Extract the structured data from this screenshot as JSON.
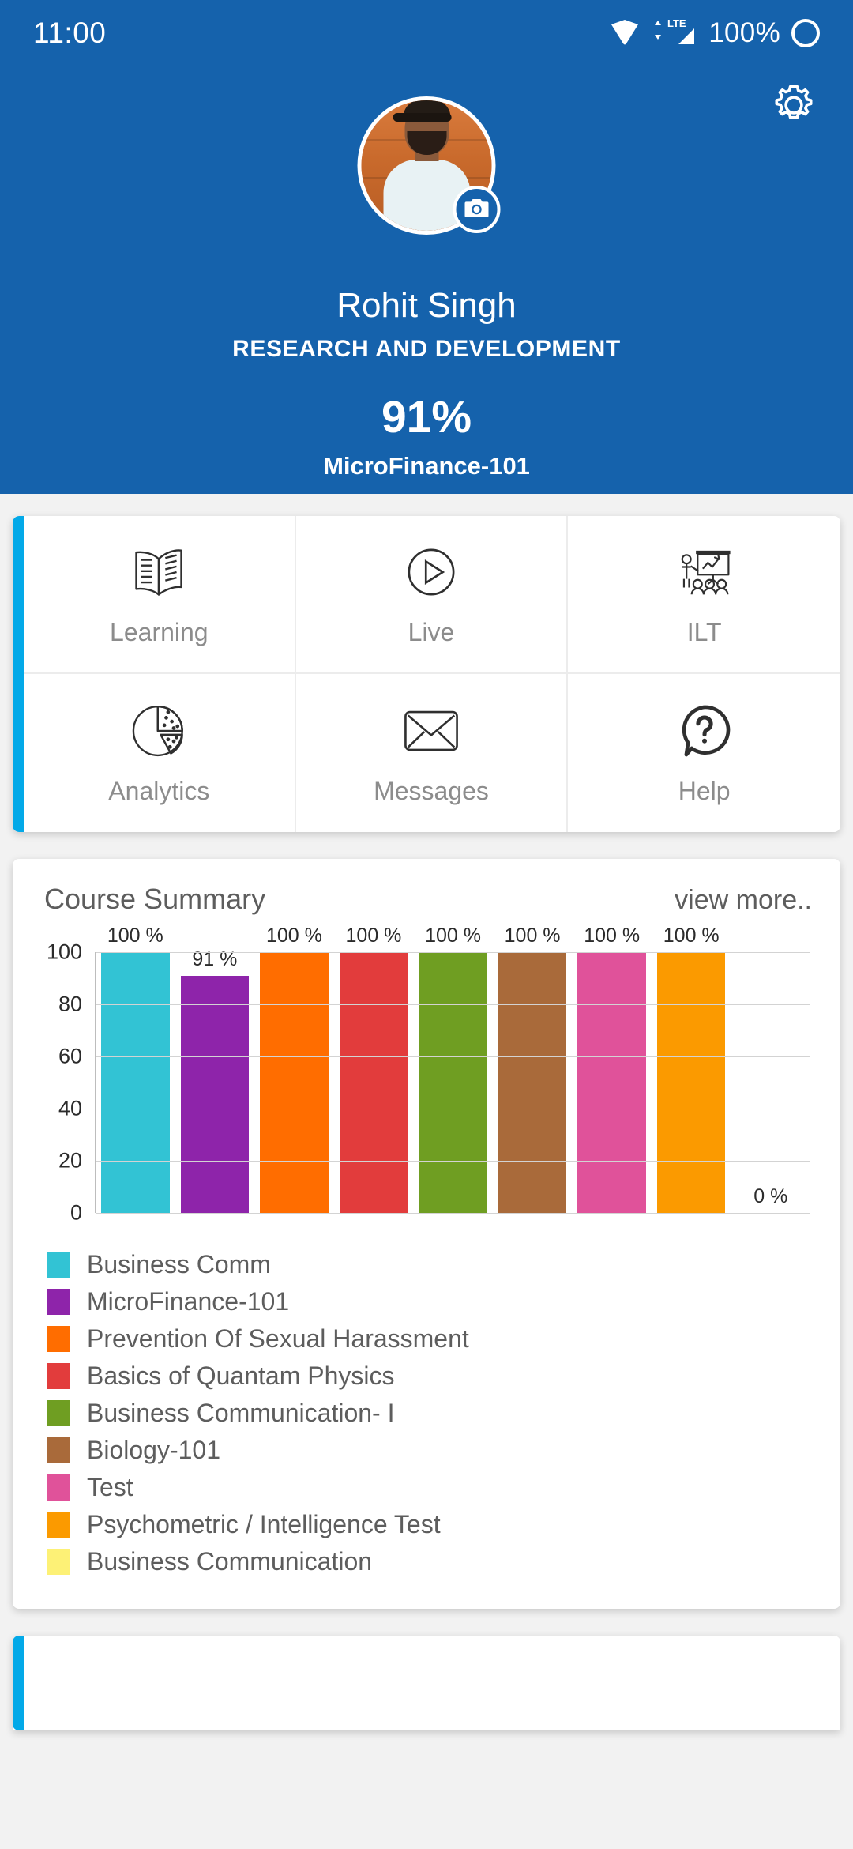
{
  "statusbar": {
    "time": "11:00",
    "battery_percent": "100%",
    "wifi_icon": "wifi-icon",
    "signal_icon": "lte-signal-icon",
    "battery_icon": "battery-ring-icon"
  },
  "header": {
    "gear_icon": "gear-icon",
    "camera_icon": "camera-icon",
    "avatar_icon": "profile-avatar",
    "user_name": "Rohit Singh",
    "department": "RESEARCH AND DEVELOPMENT",
    "progress_percent": "91%",
    "current_course": "MicroFinance-101",
    "background_color": "#1562ac"
  },
  "menu": {
    "accent_color": "#03a9e8",
    "items": [
      {
        "label": "Learning",
        "icon": "open-book-icon"
      },
      {
        "label": "Live",
        "icon": "play-circle-icon"
      },
      {
        "label": "ILT",
        "icon": "instructor-led-training-icon"
      },
      {
        "label": "Analytics",
        "icon": "pie-chart-icon"
      },
      {
        "label": "Messages",
        "icon": "envelope-icon"
      },
      {
        "label": "Help",
        "icon": "question-bubble-icon"
      }
    ]
  },
  "course_summary": {
    "title": "Course Summary",
    "view_more": "view more.."
  },
  "chart_data": {
    "type": "bar",
    "title": "Course Summary",
    "xlabel": "",
    "ylabel": "",
    "ylim": [
      0,
      100
    ],
    "yticks": [
      "0",
      "20",
      "40",
      "60",
      "80",
      "100"
    ],
    "grid": true,
    "legend_position": "below",
    "categories": [
      "Business Comm",
      "MicroFinance-101",
      "Prevention Of Sexual Harassment",
      "Basics of Quantam Physics",
      "Business Communication- I",
      "Biology-101",
      "Test",
      "Psychometric / Intelligence Test",
      "Business Communication"
    ],
    "values": [
      100,
      91,
      100,
      100,
      100,
      100,
      100,
      100,
      0
    ],
    "value_labels": [
      "100 %",
      "91 %",
      "100 %",
      "100 %",
      "100 %",
      "100 %",
      "100 %",
      "100 %",
      "0 %"
    ],
    "colors": [
      "#32c3d4",
      "#8e24aa",
      "#ff6d00",
      "#e23c3c",
      "#6f9e22",
      "#a96a3a",
      "#e0529a",
      "#fb9a00",
      "#fdf176"
    ]
  }
}
